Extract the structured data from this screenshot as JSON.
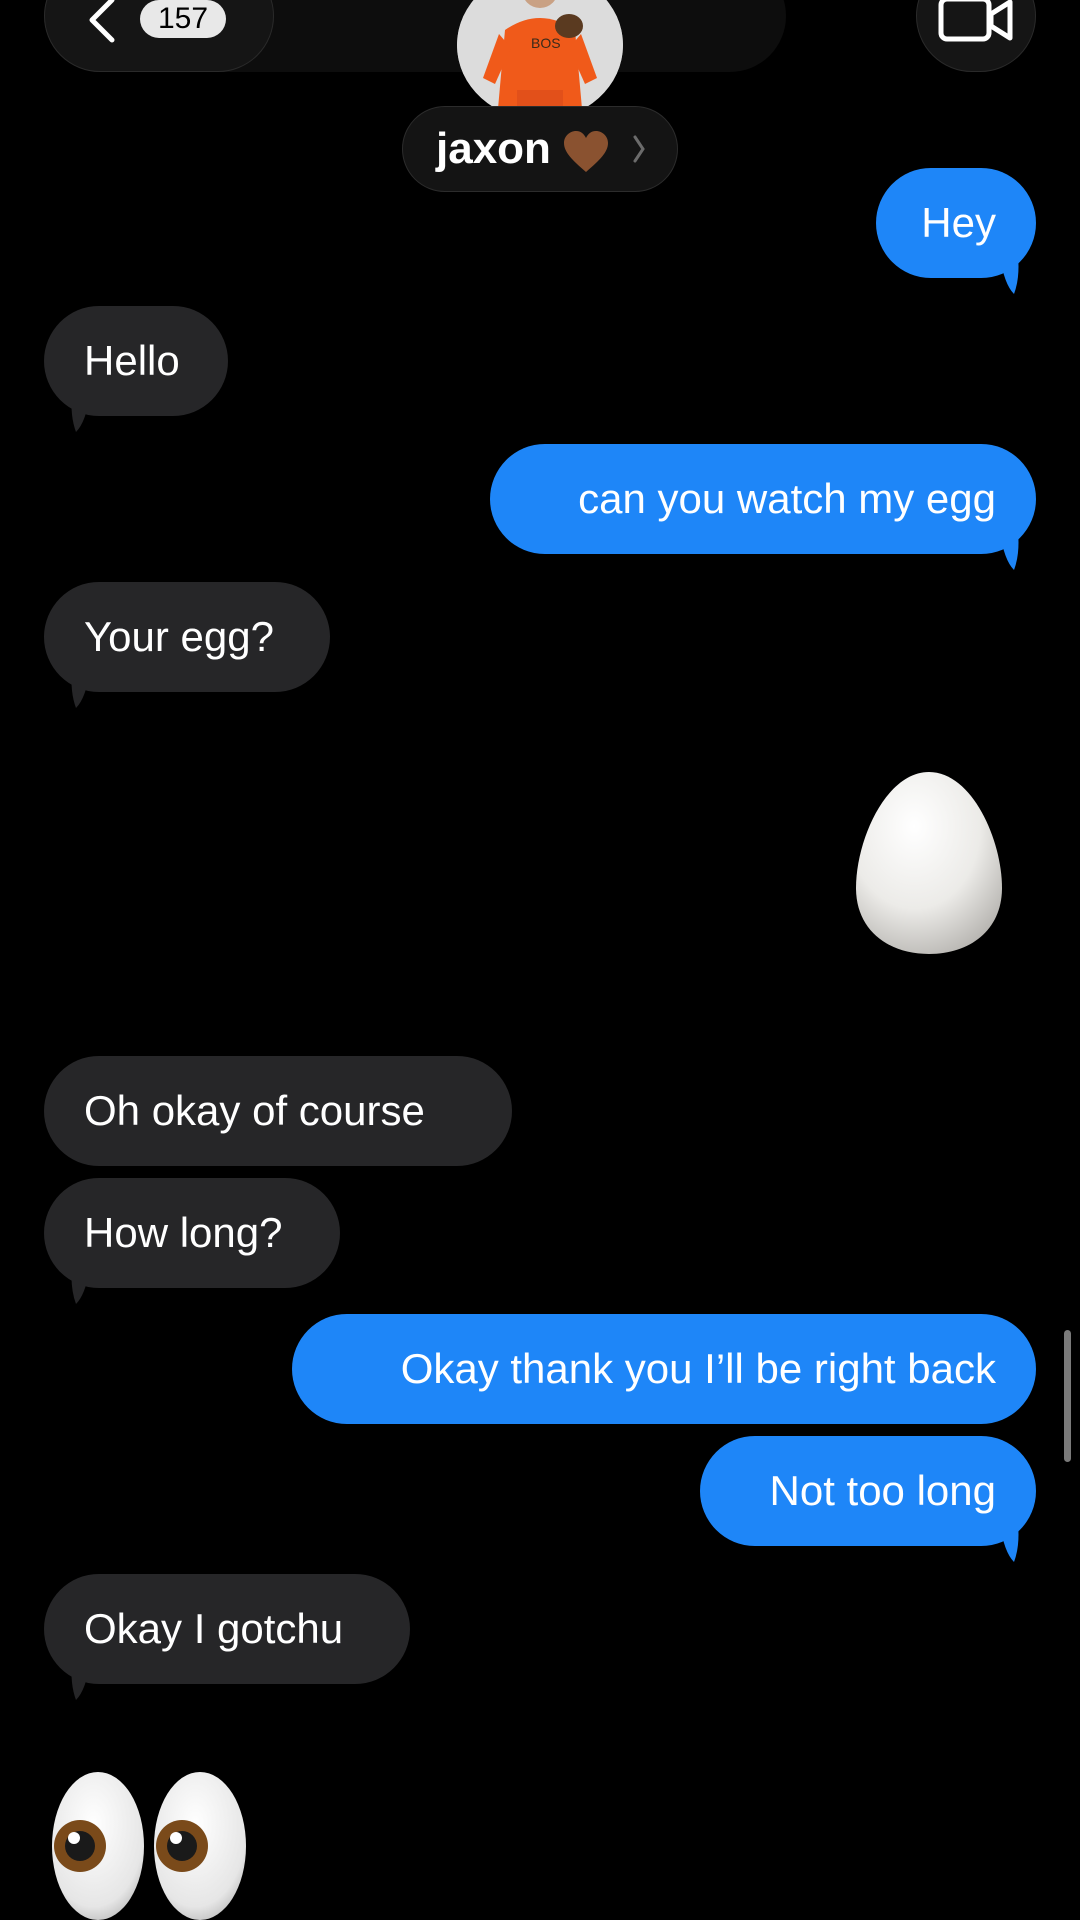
{
  "header": {
    "back_count": "157",
    "contact_name": "jaxon",
    "contact_emoji": "brown-heart-icon",
    "video_icon": "video-camera-icon"
  },
  "messages": [
    {
      "side": "out",
      "text": "Hey"
    },
    {
      "side": "in",
      "text": "Hello"
    },
    {
      "side": "out",
      "text": "can you watch my egg"
    },
    {
      "side": "in",
      "text": "Your egg?"
    },
    {
      "side": "out",
      "emoji": "egg-icon"
    },
    {
      "side": "in",
      "text": "Oh okay of course"
    },
    {
      "side": "in",
      "text": "How long?"
    },
    {
      "side": "out",
      "text": "Okay thank you I’ll be right back"
    },
    {
      "side": "out",
      "text": "Not too long"
    },
    {
      "side": "in",
      "text": "Okay I gotchu"
    },
    {
      "side": "in",
      "emoji": "eyes-icon"
    }
  ],
  "colors": {
    "outgoing": "#1e86f8",
    "incoming": "#262628",
    "background": "#000000"
  }
}
